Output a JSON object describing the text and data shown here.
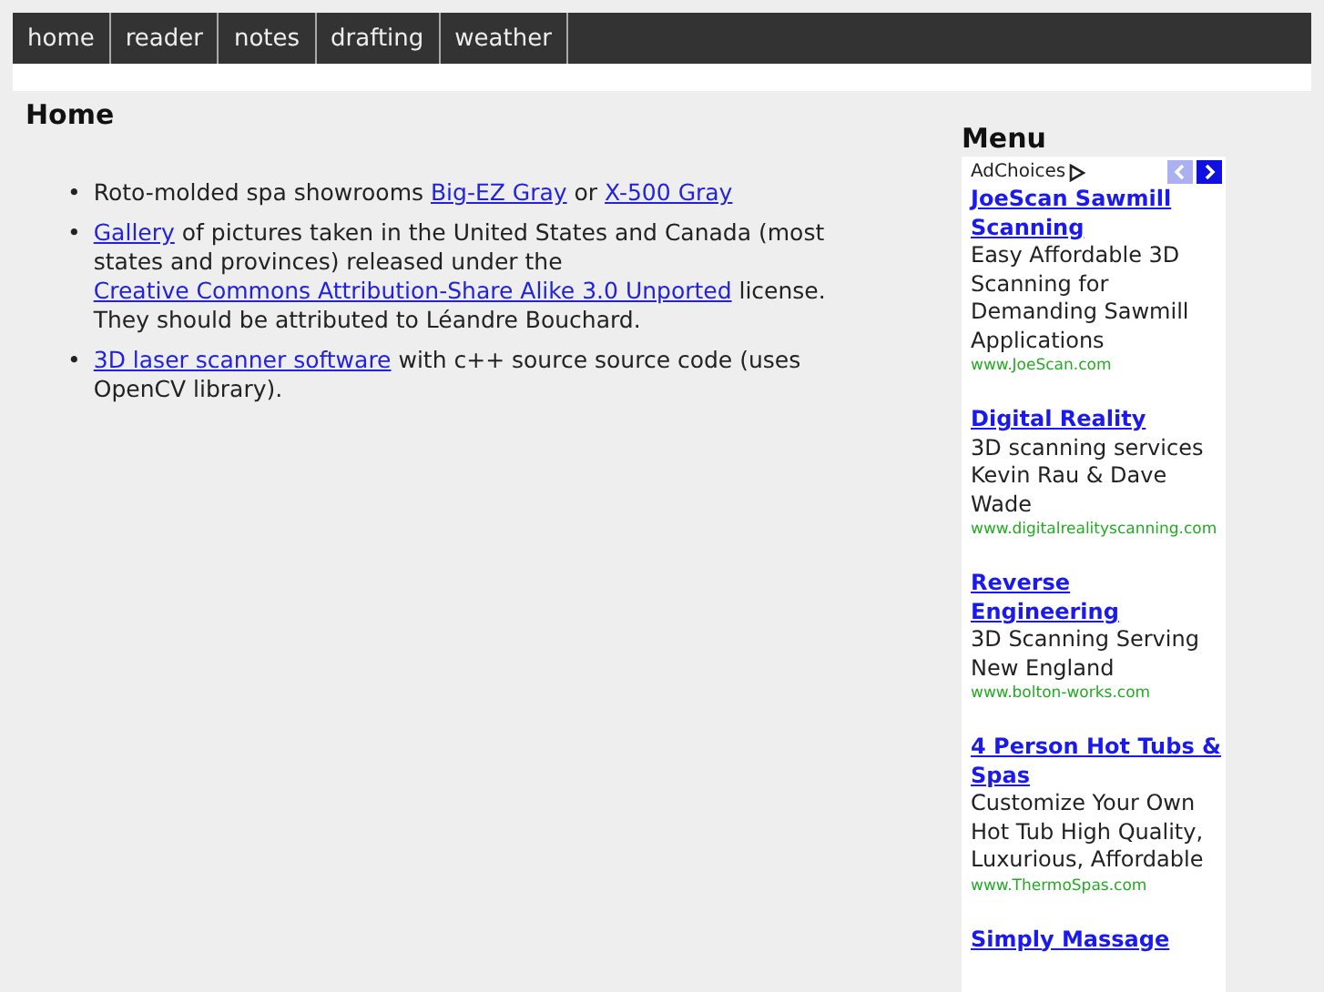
{
  "nav": [
    {
      "label": "home"
    },
    {
      "label": "reader"
    },
    {
      "label": "notes"
    },
    {
      "label": "drafting"
    },
    {
      "label": "weather"
    }
  ],
  "main": {
    "title": "Home",
    "items": [
      {
        "bullet": "•",
        "parts": [
          {
            "kind": "text",
            "text": "Roto-molded spa showrooms "
          },
          {
            "kind": "link",
            "text": "Big-EZ Gray"
          },
          {
            "kind": "text",
            "text": " or "
          },
          {
            "kind": "link",
            "text": "X-500 Gray"
          }
        ]
      },
      {
        "bullet": "•",
        "parts": [
          {
            "kind": "link",
            "text": "Gallery"
          },
          {
            "kind": "text",
            "text": " of pictures taken in the United States and Canada (most states and provinces) released under the "
          },
          {
            "kind": "link",
            "text": "Creative Commons Attribution-Share Alike 3.0 Unported"
          },
          {
            "kind": "text",
            "text": " license. They should be attributed to Léandre Bouchard."
          }
        ]
      },
      {
        "bullet": "•",
        "parts": [
          {
            "kind": "link",
            "text": "3D laser scanner software"
          },
          {
            "kind": "text",
            "text": " with c++ source source code (uses OpenCV library)."
          }
        ]
      }
    ]
  },
  "sidebar": {
    "title": "Menu",
    "ad_label": "AdChoices",
    "ads": [
      {
        "title": "JoeScan Sawmill Scanning",
        "description": "Easy Affordable 3D Scanning for Demanding Sawmill Applications",
        "url": "www.JoeScan.com"
      },
      {
        "title": "Digital Reality",
        "description": "3D scanning services Kevin Rau & Dave Wade",
        "url": "www.digitalrealityscanning.com"
      },
      {
        "title": "Reverse Engineering",
        "description": "3D Scanning Serving New England",
        "url": "www.bolton-works.com"
      },
      {
        "title": "4 Person Hot Tubs & Spas",
        "description": "Customize Your Own Hot Tub High Quality, Luxurious, Affordable",
        "url": "www.ThermoSpas.com"
      },
      {
        "title": "Simply Massage"
      }
    ]
  }
}
